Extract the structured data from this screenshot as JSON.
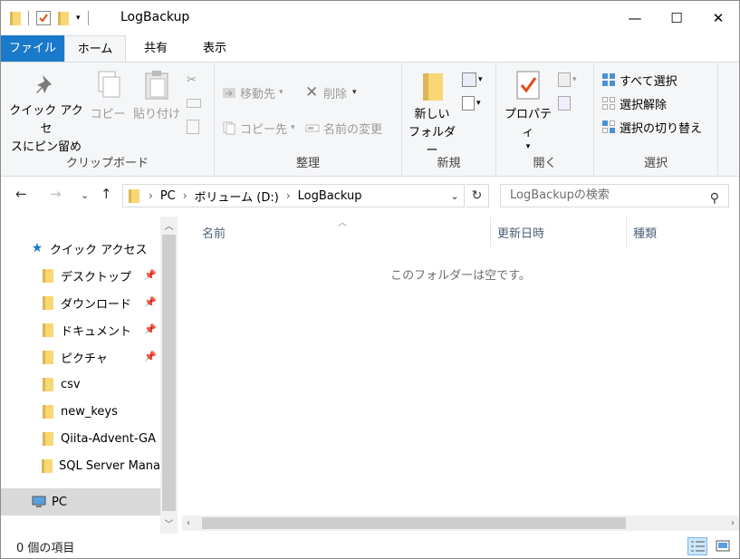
{
  "window": {
    "title": "LogBackup",
    "controls": {
      "minimize": "—",
      "maximize": "☐",
      "close": "✕"
    }
  },
  "ribbon_tabs": {
    "file": "ファイル",
    "home": "ホーム",
    "share": "共有",
    "view": "表示"
  },
  "ribbon": {
    "clipboard": {
      "label": "クリップボード",
      "pin_line1": "クイック アクセ",
      "pin_line2": "スにピン留め",
      "copy": "コピー",
      "paste": "貼り付け"
    },
    "organize": {
      "label": "整理",
      "move_to": "移動先",
      "copy_to": "コピー先",
      "delete": "削除",
      "rename": "名前の変更"
    },
    "new": {
      "label": "新規",
      "new_folder_line1": "新しい",
      "new_folder_line2": "フォルダー"
    },
    "open": {
      "label": "開く",
      "properties": "プロパティ"
    },
    "select": {
      "label": "選択",
      "select_all": "すべて選択",
      "select_none": "選択解除",
      "invert": "選択の切り替え"
    }
  },
  "address": {
    "crumbs": [
      "PC",
      "ボリューム (D:)",
      "LogBackup"
    ]
  },
  "search": {
    "placeholder": "LogBackupの検索"
  },
  "nav": {
    "quick_access": "クイック アクセス",
    "items": [
      {
        "label": "デスクトップ",
        "pinned": true,
        "icon": "desktop-folder-icon"
      },
      {
        "label": "ダウンロード",
        "pinned": true,
        "icon": "downloads-folder-icon"
      },
      {
        "label": "ドキュメント",
        "pinned": true,
        "icon": "documents-folder-icon"
      },
      {
        "label": "ピクチャ",
        "pinned": true,
        "icon": "pictures-folder-icon"
      },
      {
        "label": "csv",
        "pinned": false,
        "icon": "folder-icon"
      },
      {
        "label": "new_keys",
        "pinned": false,
        "icon": "folder-icon"
      },
      {
        "label": "Qiita-Advent-GA",
        "pinned": false,
        "icon": "folder-icon"
      },
      {
        "label": "SQL Server Mana",
        "pinned": false,
        "icon": "folder-icon"
      }
    ],
    "pc": "PC"
  },
  "columns": {
    "name": "名前",
    "modified": "更新日時",
    "type": "種類"
  },
  "content": {
    "empty_message": "このフォルダーは空です。"
  },
  "status": {
    "item_count": "0 個の項目"
  },
  "colors": {
    "accent": "#1979ca",
    "ribbon_bg": "#f5f6f7",
    "selected_nav": "#d9d9d9"
  }
}
